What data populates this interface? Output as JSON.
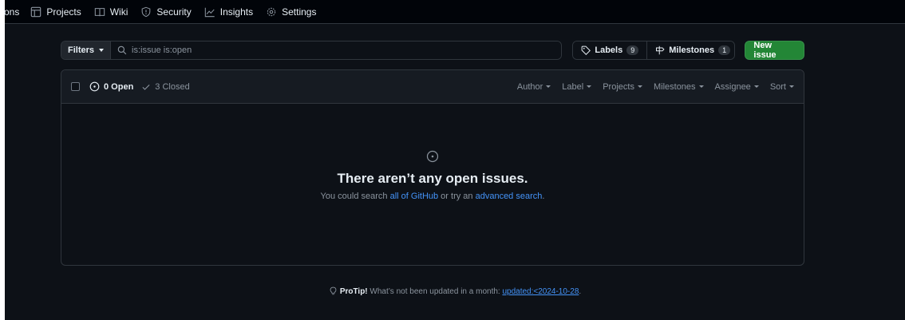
{
  "nav": {
    "cut_text": "ons",
    "items": [
      {
        "label": "Projects",
        "icon": "table-icon"
      },
      {
        "label": "Wiki",
        "icon": "book-icon"
      },
      {
        "label": "Security",
        "icon": "shield-icon"
      },
      {
        "label": "Insights",
        "icon": "graph-icon"
      },
      {
        "label": "Settings",
        "icon": "gear-icon"
      }
    ]
  },
  "toolbar": {
    "filters_label": "Filters",
    "search_value": "is:issue is:open",
    "labels_label": "Labels",
    "labels_count": "9",
    "milestones_label": "Milestones",
    "milestones_count": "1",
    "new_issue_label": "New issue"
  },
  "list_header": {
    "open_label": "0 Open",
    "closed_label": "3 Closed",
    "filters": [
      "Author",
      "Label",
      "Projects",
      "Milestones",
      "Assignee",
      "Sort"
    ]
  },
  "blankslate": {
    "title": "There aren’t any open issues.",
    "desc_prefix": "You could search ",
    "link1": "all of GitHub",
    "desc_middle": " or try an ",
    "link2": "advanced search",
    "desc_suffix": "."
  },
  "protip": {
    "label": "ProTip!",
    "text": " What’s not been updated in a month: ",
    "link": "updated:<2024-10-28",
    "suffix": "."
  },
  "colors": {
    "background": "#0d1117",
    "border": "#30363d",
    "accent_green": "#238636",
    "link_blue": "#4493f8"
  }
}
